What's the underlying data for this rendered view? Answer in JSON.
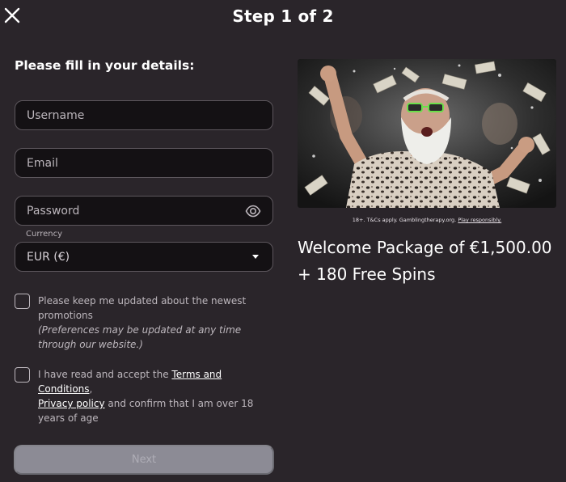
{
  "header": {
    "title": "Step 1 of 2",
    "close_icon": "close-icon"
  },
  "form": {
    "heading": "Please fill in your details:",
    "username": {
      "placeholder": "Username",
      "value": ""
    },
    "email": {
      "placeholder": "Email",
      "value": ""
    },
    "password": {
      "placeholder": "Password",
      "value": "",
      "toggle_icon": "eye-icon"
    },
    "currency": {
      "label": "Currency",
      "selected": "EUR (€)"
    },
    "promotions_consent": {
      "checked": false,
      "text": "Please keep me updated about the newest promotions",
      "note": "(Preferences may be updated at any time through our website.)"
    },
    "terms_consent": {
      "checked": false,
      "prefix": "I have read and accept the ",
      "terms_link": "Terms and Conditions",
      "comma": ",",
      "privacy_link": "Privacy policy",
      "suffix": " and confirm that I am over 18 years of age"
    },
    "next_label": "Next"
  },
  "promo": {
    "disclaimer_text": "18+. T&Cs apply. Gamblingtherapy.org. ",
    "disclaimer_link": "Play responsibly.",
    "line1": "Welcome Package of €1,500.00",
    "line2": "+ 180 Free Spins"
  },
  "colors": {
    "background": "#2a252a",
    "input_bg": "#141114",
    "input_border": "#5d575d",
    "button_disabled": "#8c8b95"
  }
}
